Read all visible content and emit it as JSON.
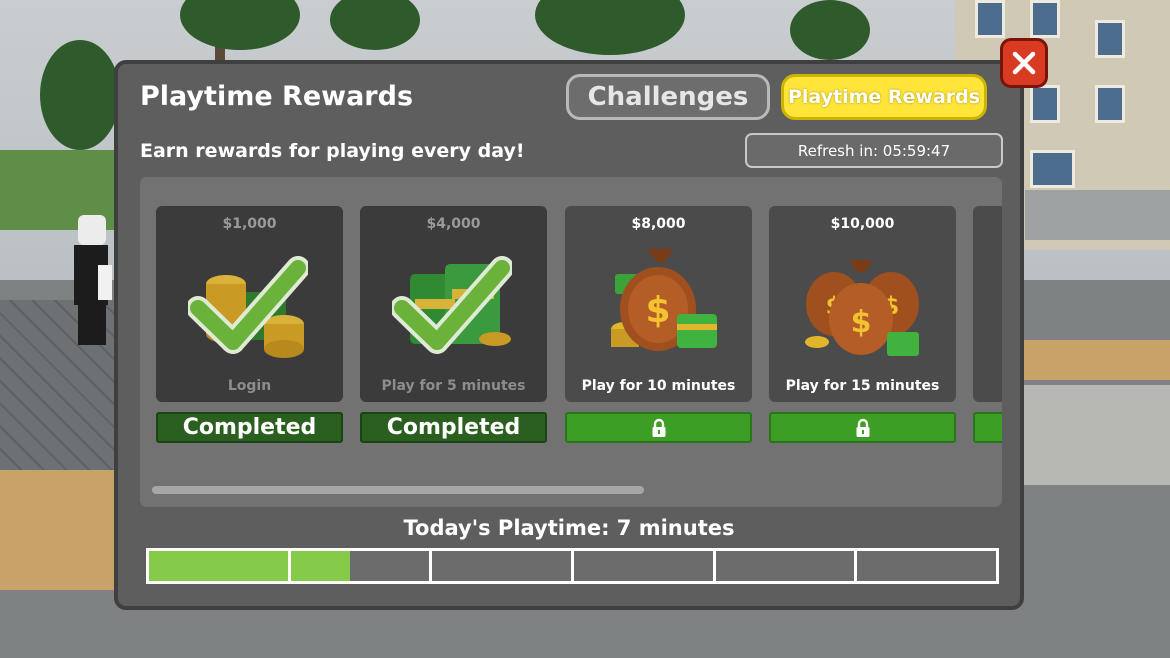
{
  "panel": {
    "title": "Playtime Rewards",
    "subtitle": "Earn rewards for playing every day!",
    "refresh": "Refresh in: 05:59:47"
  },
  "tabs": [
    {
      "label": "Challenges",
      "active": false
    },
    {
      "label": "Playtime Rewards",
      "active": true
    }
  ],
  "close_icon": "close-x-icon",
  "rewards": [
    {
      "amount": "$1,000",
      "label": "Login",
      "status": "Completed",
      "state": "completed",
      "art": "coins-icon"
    },
    {
      "amount": "$4,000",
      "label": "Play for 5 minutes",
      "status": "Completed",
      "state": "completed",
      "art": "cash-stack-icon"
    },
    {
      "amount": "$8,000",
      "label": "Play for 10 minutes",
      "status": "",
      "state": "locked",
      "art": "money-bag-icon"
    },
    {
      "amount": "$10,000",
      "label": "Play for 15 minutes",
      "status": "",
      "state": "locked",
      "art": "money-bags-icon"
    }
  ],
  "playtime": {
    "label": "Today's Playtime: 7 minutes",
    "segments": 6,
    "segment_fill": [
      1,
      0.43,
      0,
      0,
      0,
      0
    ]
  },
  "colors": {
    "accent_yellow": "#ffe53a",
    "completed_green": "#2b5f1f",
    "locked_green": "#3c9e24",
    "progress_green": "#86ca4a",
    "close_red": "#d93a22"
  }
}
